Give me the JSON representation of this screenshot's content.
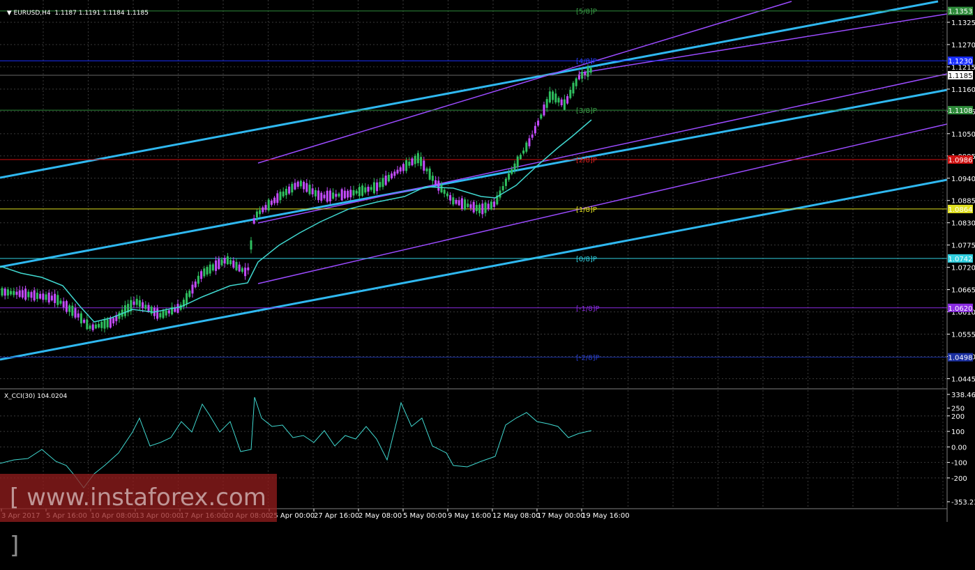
{
  "header": {
    "symbol_label": "EURUSD,H4",
    "ohlc": "1.1187 1.1191 1.1184 1.1185",
    "indicator_label": "X_CCI(30) 104.0204"
  },
  "colors": {
    "background": "#000000",
    "grid": "#3a3a3a",
    "candle_up": "#2fbf5f",
    "candle_down": "#c44cff",
    "ma": "#40d8d0",
    "trend_thick": "#2fb8f0",
    "channel": "#9b4bff",
    "cci": "#40d8d0"
  },
  "price_axis": {
    "ticks": [
      "1.1325",
      "1.1270",
      "1.1215",
      "1.1160",
      "1.1105",
      "1.1050",
      "1.0995",
      "1.0940",
      "1.0885",
      "1.0830",
      "1.0775",
      "1.0720",
      "1.0665",
      "1.0610",
      "1.0555",
      "1.0500",
      "1.0445"
    ]
  },
  "cci_axis": {
    "ticks": [
      "338.4682",
      "250",
      "200",
      "100",
      "0.00",
      "-100",
      "-200",
      "-353.231"
    ]
  },
  "time_axis": {
    "ticks": [
      "3 Apr 2017",
      "5 Apr 16:00",
      "10 Apr 08:00",
      "13 Apr 00:00",
      "17 Apr 16:00",
      "20 Apr 08:00",
      "25 Apr 00:00",
      "27 Apr 16:00",
      "2 May 08:00",
      "5 May 00:00",
      "9 May 16:00",
      "12 May 08:00",
      "17 May 00:00",
      "19 May 16:00"
    ]
  },
  "levels": [
    {
      "label": "[5/8]P",
      "price_tag": "1.1353",
      "color": "#2e8b3a",
      "text_color": "#3aa048"
    },
    {
      "label": "[4/8]P",
      "price_tag": "1.1230",
      "color": "#1a2fff",
      "text_color": "#2a3fff"
    },
    {
      "label": "[3/8]P",
      "price_tag": "1.1108",
      "color": "#2e8b3a",
      "text_color": "#3aa048"
    },
    {
      "label": "[2/8]P",
      "price_tag": "1.0986",
      "color": "#d01010",
      "text_color": "#e02020"
    },
    {
      "label": "[1/8]P",
      "price_tag": "1.0864",
      "color": "#e0e020",
      "text_color": "#e0e020"
    },
    {
      "label": "[0/8]P",
      "price_tag": "1.0742",
      "color": "#30d0e0",
      "text_color": "#30d0e0"
    },
    {
      "label": "[-1/8]P",
      "price_tag": "1.0620",
      "color": "#8a2be2",
      "text_color": "#8a2be2"
    },
    {
      "label": "[-2/8]P",
      "price_tag": "1.0498",
      "color": "#1a2fa0",
      "text_color": "#2a3fd0"
    }
  ],
  "current_price": "1.1185",
  "watermark": "[ www.instaforex.com ]"
}
